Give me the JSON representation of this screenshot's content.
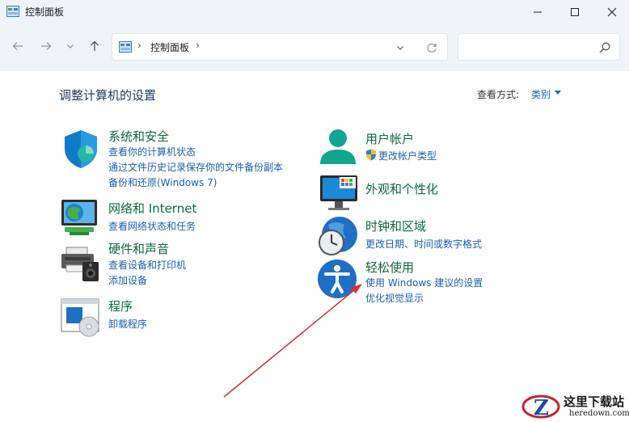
{
  "window": {
    "title": "控制面板",
    "minimize_icon": "minimize-icon",
    "maximize_icon": "maximize-icon",
    "close_icon": "close-icon"
  },
  "nav": {
    "back_icon": "arrow-left-icon",
    "forward_icon": "arrow-right-icon",
    "recent_icon": "chevron-down-icon",
    "up_icon": "arrow-up-icon"
  },
  "address": {
    "separator": "›",
    "crumb": "控制面板",
    "dropdown_icon": "chevron-down-icon",
    "refresh_icon": "refresh-icon"
  },
  "search": {
    "placeholder": "",
    "icon": "search-icon"
  },
  "content": {
    "heading": "调整计算机的设置",
    "view_label": "查看方式:",
    "view_value": "类别"
  },
  "categories_left": [
    {
      "title": "系统和安全",
      "icon": "shield-icon",
      "links": [
        "查看你的计算机状态",
        "通过文件历史记录保存你的文件备份副本",
        "备份和还原(Windows 7)"
      ]
    },
    {
      "title": "网络和 Internet",
      "icon": "network-globe-icon",
      "links": [
        "查看网络状态和任务"
      ]
    },
    {
      "title": "硬件和声音",
      "icon": "printer-speaker-icon",
      "links": [
        "查看设备和打印机",
        "添加设备"
      ]
    },
    {
      "title": "程序",
      "icon": "programs-disc-icon",
      "links": [
        "卸载程序"
      ]
    }
  ],
  "categories_right": [
    {
      "title": "用户帐户",
      "icon": "user-icon",
      "links": [
        "更改帐户类型"
      ]
    },
    {
      "title": "外观和个性化",
      "icon": "monitor-icon",
      "links": []
    },
    {
      "title": "时钟和区域",
      "icon": "clock-globe-icon",
      "links": [
        "更改日期、时间或数字格式"
      ]
    },
    {
      "title": "轻松使用",
      "icon": "accessibility-icon",
      "links": [
        "使用 Windows 建议的设置",
        "优化视觉显示"
      ]
    }
  ],
  "colors": {
    "category_title": "#0b6a3c",
    "link": "#1a5fb4",
    "heading": "#1e3b5a",
    "annotation_arrow": "#d9302b"
  },
  "watermark": {
    "name": "这里下载站",
    "domain": "heredown.com"
  }
}
